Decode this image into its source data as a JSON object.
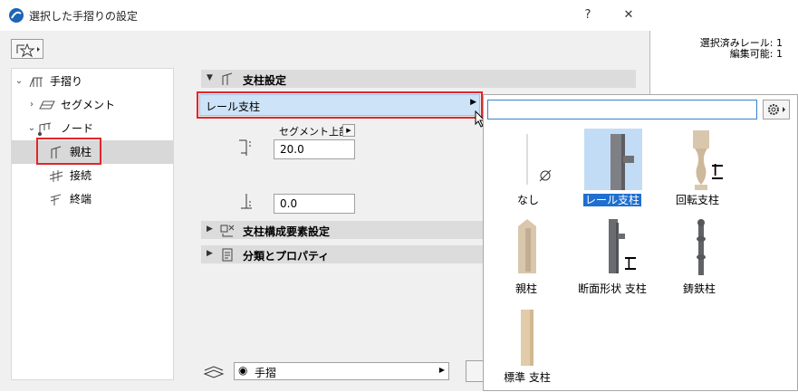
{
  "window": {
    "title": "選択した手摺りの設定",
    "help": "?",
    "close": "✕"
  },
  "selection_info": {
    "line1": "選択済みレール: 1",
    "line2": "編集可能: 1"
  },
  "tree": {
    "items": [
      {
        "label": "手摺り"
      },
      {
        "label": "セグメント"
      },
      {
        "label": "ノード"
      },
      {
        "label": "親柱"
      },
      {
        "label": "接続"
      },
      {
        "label": "終端"
      }
    ]
  },
  "sections": {
    "post_settings": "支柱設定",
    "post_components": "支柱構成要素設定",
    "classification": "分類とプロパティ"
  },
  "post": {
    "selected": "レール支柱",
    "segment_top_label": "セグメント上部",
    "top_value": "20.0",
    "bottom_value": "0.0"
  },
  "popup": {
    "search_value": "",
    "items": [
      {
        "label": "なし"
      },
      {
        "label": "レール支柱"
      },
      {
        "label": "回転支柱"
      },
      {
        "label": "親柱"
      },
      {
        "label": "断面形状 支柱"
      },
      {
        "label": "鋳鉄柱"
      },
      {
        "label": "標準 支柱"
      }
    ]
  },
  "footer": {
    "layer": "手摺"
  },
  "colors": {
    "highlight": "#cde3f7",
    "selected_tile": "#c3dcf5",
    "caption_selected": "#1e6fd0",
    "red_outline": "#e0262b",
    "wood": "#d9c7ad"
  }
}
